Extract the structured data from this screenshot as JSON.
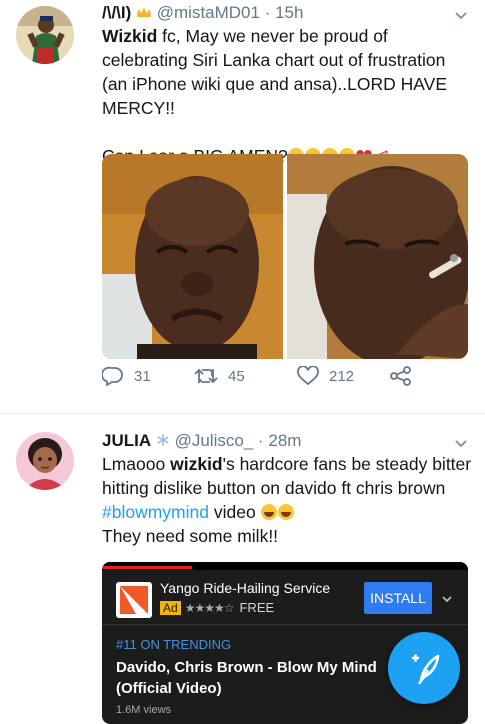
{
  "tweet1": {
    "display_name_glyph": "/\\/\\I)",
    "handle": "@mistaMD01",
    "time": "· 15h",
    "text_bold": "Wizkid",
    "text_rest": " fc, May we never be proud of celebrating Siri Lanka chart out of frustration (an iPhone wiki que and ansa)..LORD HAVE MERCY!!",
    "text_line2": "Can I ear a BIG AMEN?",
    "replies": "31",
    "retweets": "45",
    "likes": "212"
  },
  "tweet2": {
    "display_name": "JULIA",
    "handle": "@Julisco_",
    "time": "· 28m",
    "line1_pre": "Lmaooo ",
    "line1_bold": "wizkid",
    "line1_post": "'s hardcore fans be steady bitter hitting dislike button on davido ft chris brown",
    "hashtag": "#blowmymind",
    "after_hashtag": " video",
    "line3": "They need some milk!!"
  },
  "ad": {
    "app_name": "Yango Ride-Hailing Service",
    "badge": "Ad",
    "price": "FREE",
    "install_label": "INSTALL",
    "trending": "#11 ON TRENDING",
    "video_title": "Davido, Chris Brown - Blow My Mind (Official Video)",
    "views": "1.6M views"
  },
  "colors": {
    "accent": "#1da1f2",
    "muted": "#657786",
    "install": "#2f7cf2",
    "ad_badge": "#f4b400"
  },
  "icons": [
    "crown-icon",
    "chevron-down-icon",
    "reply-icon",
    "retweet-icon",
    "like-icon",
    "share-icon",
    "snowflake-icon",
    "compose-icon"
  ]
}
